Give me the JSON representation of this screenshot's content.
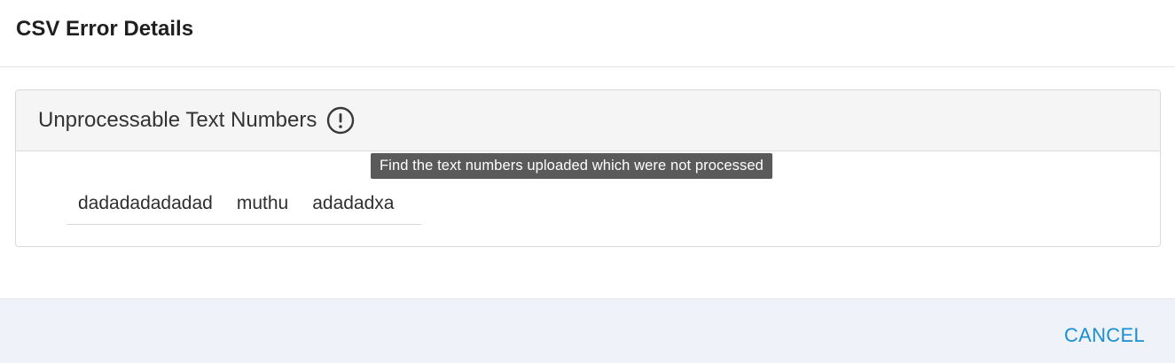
{
  "dialog": {
    "title": "CSV Error Details"
  },
  "panel": {
    "title": "Unprocessable Text Numbers",
    "info_icon": "exclamation-circle-icon",
    "tooltip": "Find the text numbers uploaded which were not processed",
    "items": [
      "dadadadadadad",
      "muthu",
      "adadadxa"
    ]
  },
  "footer": {
    "cancel_label": "CANCEL"
  },
  "colors": {
    "accent": "#1a8fd1",
    "footer_bg": "#eff2f9",
    "panel_header_bg": "#f5f5f5",
    "tooltip_bg": "#5a5a5a"
  }
}
